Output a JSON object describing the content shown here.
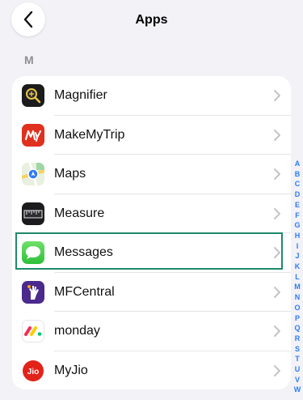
{
  "header": {
    "title": "Apps"
  },
  "section_letter": "M",
  "apps": [
    {
      "label": "Magnifier",
      "icon": "magnifier-icon"
    },
    {
      "label": "MakeMyTrip",
      "icon": "makemytrip-icon"
    },
    {
      "label": "Maps",
      "icon": "maps-icon"
    },
    {
      "label": "Measure",
      "icon": "measure-icon"
    },
    {
      "label": "Messages",
      "icon": "messages-icon"
    },
    {
      "label": "MFCentral",
      "icon": "mfcentral-icon"
    },
    {
      "label": "monday",
      "icon": "monday-icon"
    },
    {
      "label": "MyJio",
      "icon": "myjio-icon"
    }
  ],
  "index_letters": [
    "A",
    "B",
    "C",
    "D",
    "E",
    "F",
    "G",
    "H",
    "I",
    "J",
    "K",
    "L",
    "M",
    "N",
    "O",
    "P",
    "Q",
    "R",
    "S",
    "T",
    "U",
    "V",
    "W"
  ],
  "colors": {
    "accent": "#2e7cf6",
    "highlight": "#1f8a6b",
    "background": "#f2f2f7"
  }
}
